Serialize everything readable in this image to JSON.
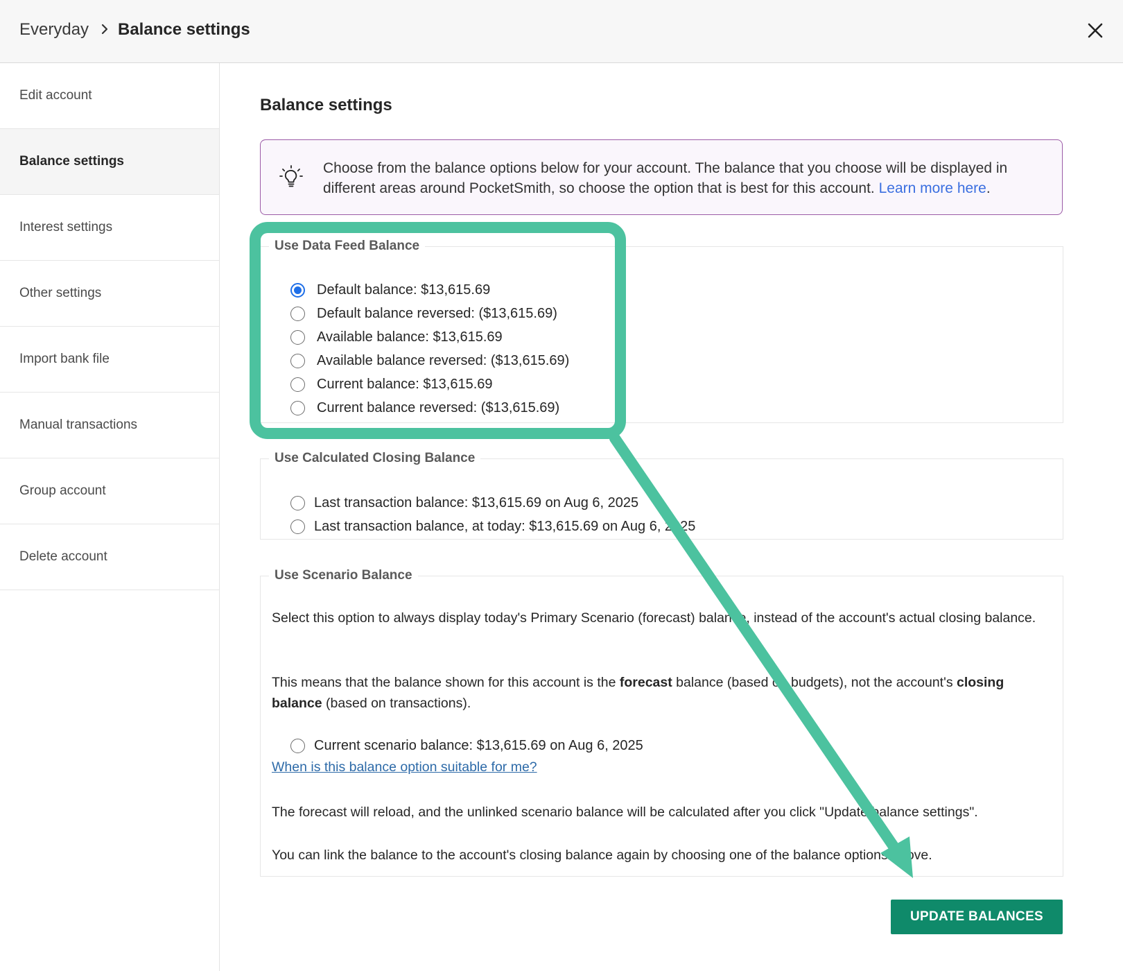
{
  "header": {
    "breadcrumb_parent": "Everyday",
    "breadcrumb_current": "Balance settings",
    "close_icon": "close-icon"
  },
  "sidebar": {
    "items": [
      {
        "label": "Edit account",
        "active": false
      },
      {
        "label": "Balance settings",
        "active": true
      },
      {
        "label": "Interest settings",
        "active": false
      },
      {
        "label": "Other settings",
        "active": false
      },
      {
        "label": "Import bank file",
        "active": false
      },
      {
        "label": "Manual transactions",
        "active": false
      },
      {
        "label": "Group account",
        "active": false
      },
      {
        "label": "Delete account",
        "active": false
      }
    ]
  },
  "main": {
    "title": "Balance settings",
    "info": {
      "icon": "lightbulb-icon",
      "text": "Choose from the balance options below for your account. The balance that you choose will be displayed in different areas around PocketSmith, so choose the option that is best for this account.",
      "link_text": "Learn more here",
      "trailing": "."
    },
    "data_feed": {
      "legend": "Use Data Feed Balance",
      "options": [
        {
          "label": "Default balance: $13,615.69",
          "checked": true
        },
        {
          "label": "Default balance reversed: ($13,615.69)",
          "checked": false
        },
        {
          "label": "Available balance: $13,615.69",
          "checked": false
        },
        {
          "label": "Available balance reversed: ($13,615.69)",
          "checked": false
        },
        {
          "label": "Current balance: $13,615.69",
          "checked": false
        },
        {
          "label": "Current balance reversed: ($13,615.69)",
          "checked": false
        }
      ]
    },
    "calculated": {
      "legend": "Use Calculated Closing Balance",
      "options": [
        {
          "label": "Last transaction balance: $13,615.69 on Aug 6, 2025",
          "checked": false
        },
        {
          "label": "Last transaction balance, at today: $13,615.69 on Aug 6, 2025",
          "checked": false
        }
      ]
    },
    "scenario": {
      "legend": "Use Scenario Balance",
      "para1": "Select this option to always display today's Primary Scenario (forecast) balance, instead of the account's actual closing balance.",
      "para2_a": "This means that the balance shown for this account is the ",
      "para2_b": "forecast",
      "para2_c": " balance (based on budgets), not the account's ",
      "para2_d": "closing balance",
      "para2_e": " (based on transactions).",
      "option": {
        "label": "Current scenario balance: $13,615.69 on Aug 6, 2025",
        "checked": false
      },
      "help_link": "When is this balance option suitable for me?",
      "para3": "The forecast will reload, and the unlinked scenario balance will be calculated after you click \"Update balance settings\".",
      "para4": "You can link the balance to the account's closing balance again by choosing one of the balance options above."
    },
    "update_button": "UPDATE BALANCES"
  },
  "annotation": {
    "color": "#4cc29f"
  }
}
